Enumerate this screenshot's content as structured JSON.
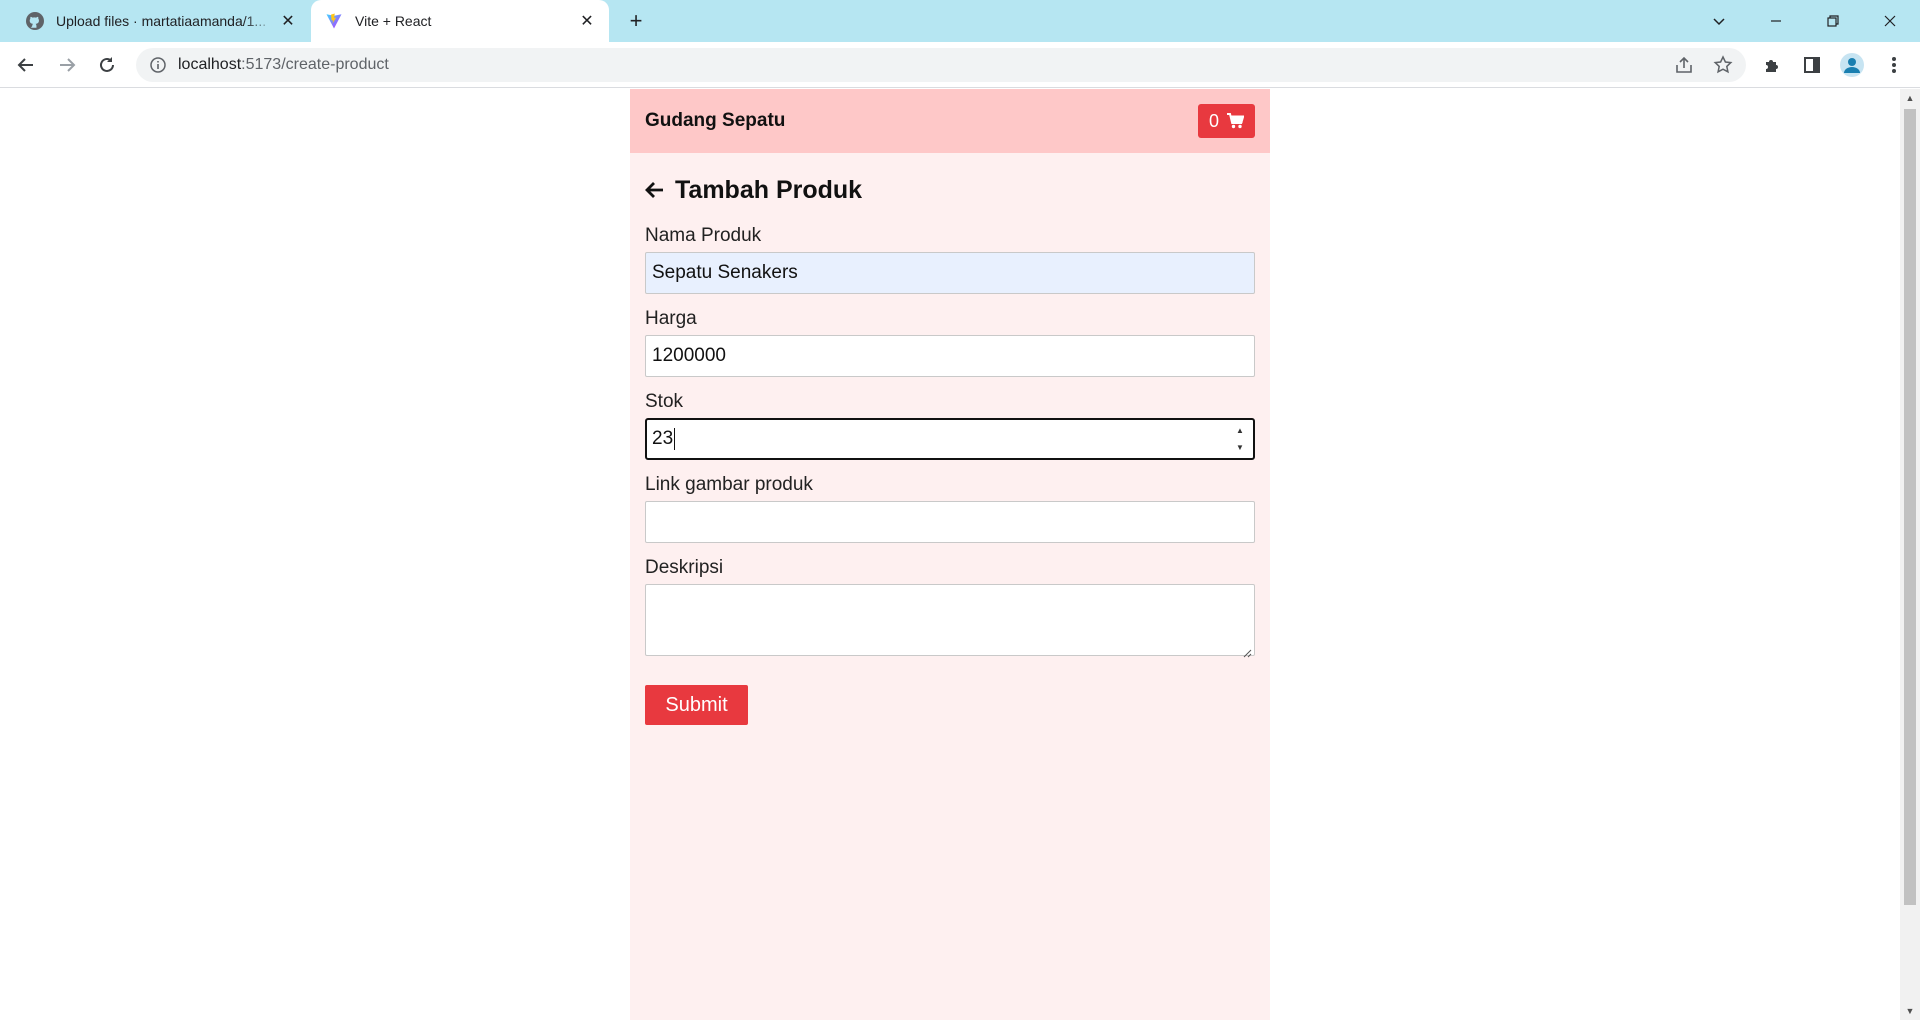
{
  "browser": {
    "tabs": [
      {
        "title": "Upload files · martatiaamanda/1...",
        "icon": "github-icon",
        "active": false
      },
      {
        "title": "Vite + React",
        "icon": "vite-icon",
        "active": true
      }
    ],
    "url_host": "localhost",
    "url_rest": ":5173/create-product"
  },
  "app": {
    "brand": "Gudang Sepatu",
    "cart_count": "0",
    "colors": {
      "header_bg": "#fec8c8",
      "page_bg": "#fef0f0",
      "accent": "#e8393f"
    }
  },
  "form": {
    "heading": "Tambah Produk",
    "fields": {
      "name": {
        "label": "Nama Produk",
        "value": "Sepatu Senakers"
      },
      "price": {
        "label": "Harga",
        "value": "1200000"
      },
      "stock": {
        "label": "Stok",
        "value": "23"
      },
      "image": {
        "label": "Link gambar produk",
        "value": ""
      },
      "description": {
        "label": "Deskripsi",
        "value": ""
      }
    },
    "submit_label": "Submit"
  }
}
